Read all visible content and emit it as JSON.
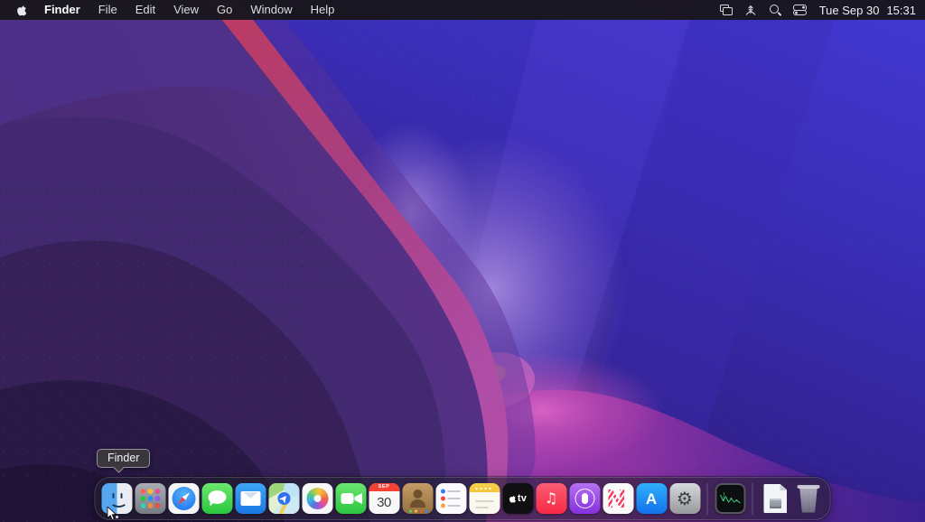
{
  "menu_bar": {
    "apple_menu_icon": "apple-logo",
    "menus": [
      {
        "label": "Finder",
        "active_app": true
      },
      {
        "label": "File"
      },
      {
        "label": "Edit"
      },
      {
        "label": "View"
      },
      {
        "label": "Go"
      },
      {
        "label": "Window"
      },
      {
        "label": "Help"
      }
    ],
    "status_icons": [
      {
        "name": "screen-mirroring-icon"
      },
      {
        "name": "remote-desktop-icon"
      },
      {
        "name": "spotlight-search-icon"
      },
      {
        "name": "control-center-icon"
      }
    ],
    "clock": {
      "date": "Tue Sep 30",
      "time": "15:31"
    }
  },
  "desktop": {
    "wallpaper_name": "macos-monterey-purple-waves",
    "colors": {
      "sky_blue": "#4238d2",
      "left_purple": "#5c3590",
      "deep_purple": "#2a1868",
      "ridge_magenta": "#b04387",
      "ridge_crimson": "#c23c5e",
      "pink_glow": "#e873c8"
    }
  },
  "tooltip": {
    "text": "Finder"
  },
  "dock": {
    "items": [
      {
        "name": "finder",
        "running": true
      },
      {
        "name": "launchpad"
      },
      {
        "name": "safari"
      },
      {
        "name": "messages"
      },
      {
        "name": "mail"
      },
      {
        "name": "maps"
      },
      {
        "name": "photos"
      },
      {
        "name": "facetime"
      },
      {
        "name": "calendar"
      },
      {
        "name": "contacts"
      },
      {
        "name": "reminders"
      },
      {
        "name": "notes"
      },
      {
        "name": "tv"
      },
      {
        "name": "music"
      },
      {
        "name": "podcasts"
      },
      {
        "name": "news"
      },
      {
        "name": "app-store"
      },
      {
        "name": "system-preferences"
      },
      {
        "name": "activity-window-thumbnail"
      },
      {
        "name": "document-file"
      },
      {
        "name": "trash"
      }
    ],
    "calendar": {
      "month": "SEP",
      "day": "30"
    },
    "tv_label": "tv"
  }
}
